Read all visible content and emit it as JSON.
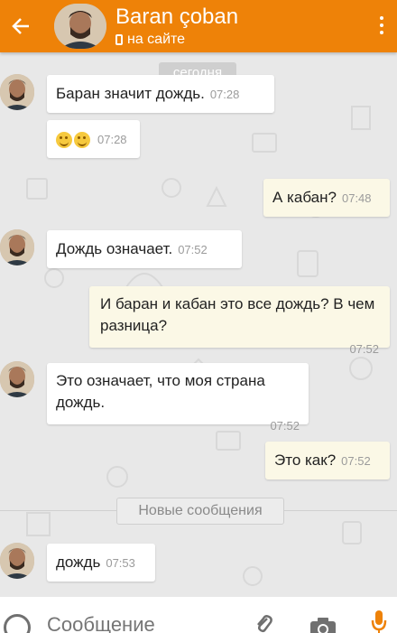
{
  "header": {
    "back_icon": "arrow-left-icon",
    "name": "Baran çoban",
    "status": "на сайте",
    "menu_icon": "more-vertical-icon",
    "color": "#ee8208"
  },
  "chat": {
    "date_label": "сегодня",
    "new_messages_label": "Новые сообщения",
    "messages": [
      {
        "dir": "in",
        "text": "Баран значит дождь.",
        "time": "07:28"
      },
      {
        "dir": "in",
        "text": "😊😊",
        "time": "07:28"
      },
      {
        "dir": "out",
        "text": "А кабан?",
        "time": "07:48"
      },
      {
        "dir": "in",
        "text": "Дождь означает.",
        "time": "07:52"
      },
      {
        "dir": "out",
        "text": "И баран и кабан это все дождь? В чем разница?",
        "time": "07:52"
      },
      {
        "dir": "in",
        "text": "Это означает, что моя страна дождь.",
        "time": "07:52"
      },
      {
        "dir": "out",
        "text": "Это как?",
        "time": "07:52"
      },
      {
        "dir": "in",
        "text": "дождь",
        "time": "07:53"
      }
    ]
  },
  "composer": {
    "placeholder": "Сообщение",
    "emoji_icon": "smile-icon",
    "attach_icon": "paperclip-icon",
    "camera_icon": "camera-icon",
    "mic_icon": "microphone-icon"
  },
  "colors": {
    "accent": "#ee8208",
    "incoming_bubble": "#ffffff",
    "outgoing_bubble": "#fbf8e6",
    "background": "#e8e8e8"
  }
}
